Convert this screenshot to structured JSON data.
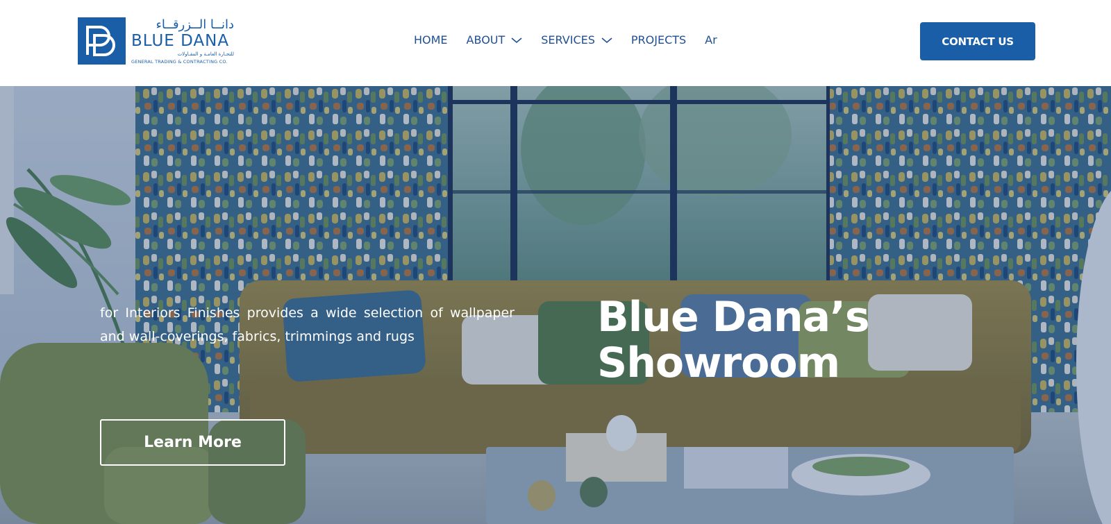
{
  "header": {
    "logo": {
      "arabic_name": "دانــا الــزرقــاء",
      "name": "BLUE DANA",
      "arabic_sub": "للتجـارة العامـة و المقـاولات",
      "tagline": "GENERAL TRADING & CONTRACTING CO."
    },
    "nav": [
      {
        "label": "HOME",
        "has_dropdown": false
      },
      {
        "label": "ABOUT",
        "has_dropdown": true
      },
      {
        "label": "SERVICES",
        "has_dropdown": true
      },
      {
        "label": "PROJECTS",
        "has_dropdown": false
      },
      {
        "label": "Ar",
        "has_dropdown": false
      }
    ],
    "contact_label": "CONTACT US"
  },
  "hero": {
    "description": "for Interiors Finishes provides a wide selection of wallpaper and wall-coverings, fabrics, trimmings and rugs",
    "title_line1": "Blue Dana’s",
    "title_line2": "Showroom",
    "cta_label": "Learn More",
    "background": "living-room-photo"
  },
  "colors": {
    "brand": "#1a5ea8",
    "nav_text": "#1e4f93",
    "hero_text": "#ffffff"
  }
}
